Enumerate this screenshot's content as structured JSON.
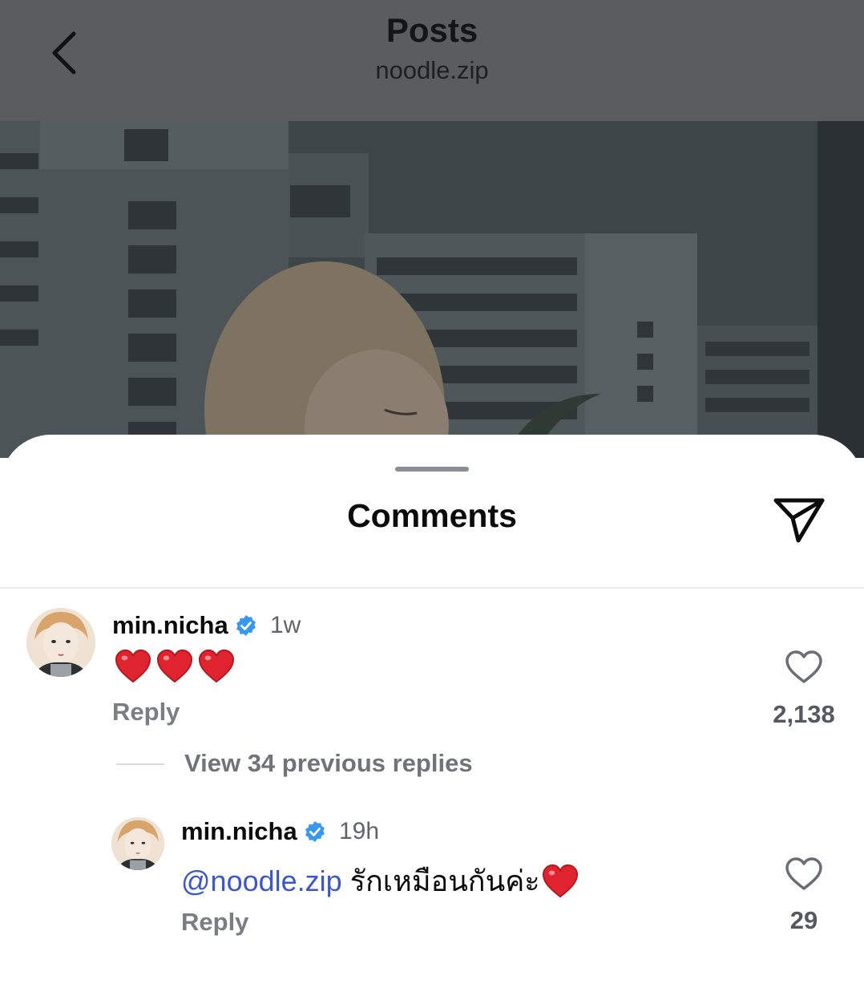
{
  "header": {
    "title": "Posts",
    "subtitle": "noodle.zip",
    "back_icon": "chevron-left-icon"
  },
  "sheet": {
    "title": "Comments",
    "share_icon": "paper-plane-icon"
  },
  "comments": [
    {
      "username": "min.nicha",
      "verified": true,
      "time": "1w",
      "text": "❤️❤️❤️",
      "reply_label": "Reply",
      "likes": "2,138"
    }
  ],
  "view_replies_label": "View 34 previous replies",
  "replies": [
    {
      "username": "min.nicha",
      "verified": true,
      "time": "19h",
      "mention": "@noodle.zip",
      "text": "รักเหมือนกันค่ะ",
      "text_emoji": "❤️",
      "reply_label": "Reply",
      "likes": "29"
    }
  ],
  "colors": {
    "header_bg": "#5a5c5e",
    "mention": "#3e57c8",
    "verified": "#3897f0",
    "heart": "#e0242f"
  }
}
